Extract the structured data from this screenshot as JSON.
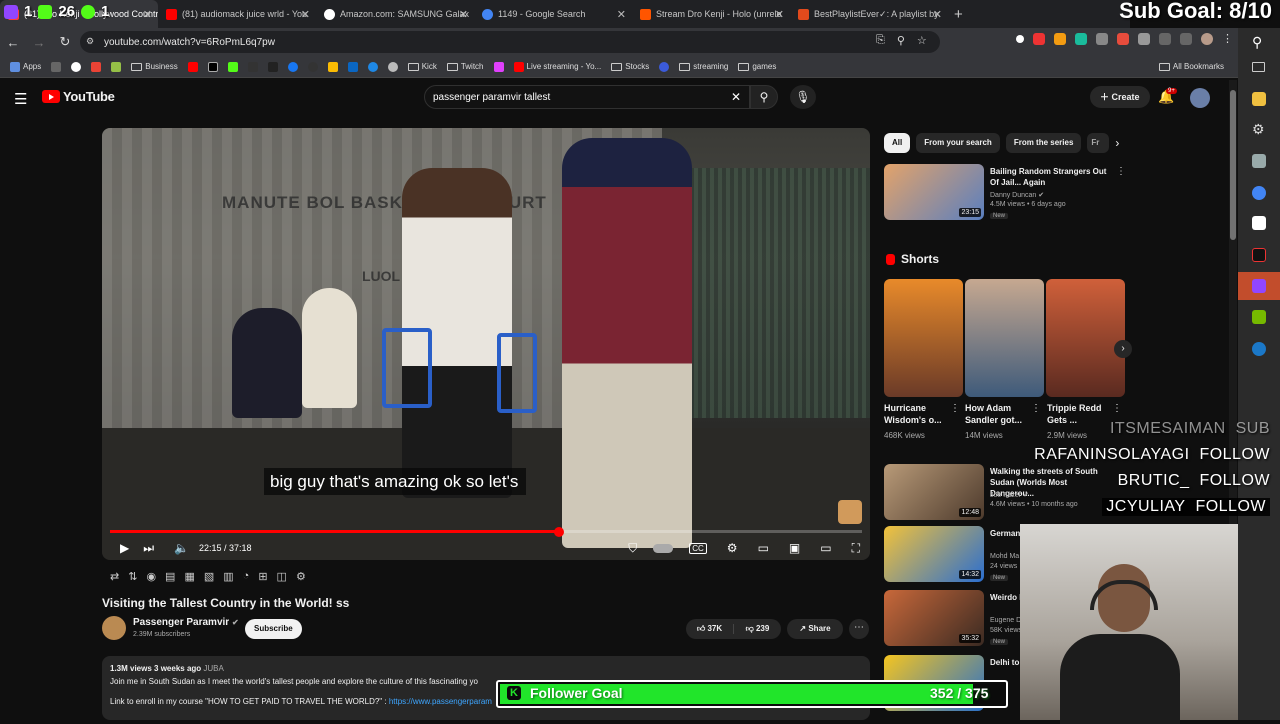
{
  "browser": {
    "tabs": [
      {
        "title": "(81) Dro Kenji - Hollywood Country",
        "color": "#ff3b3b"
      },
      {
        "title": "(81) audiomack juice wrld - You",
        "color": "#ff0000"
      },
      {
        "title": "Amazon.com: SAMSUNG Galax",
        "color": "#ffffff"
      },
      {
        "title": "1149 - Google Search",
        "color": "#4285f4"
      },
      {
        "title": "Stream Dro Kenji - Holo (unrele",
        "color": "#ff5500"
      },
      {
        "title": "BestPlaylistEver✓: A playlist by",
        "color": "#e24a1c"
      }
    ],
    "url": "youtube.com/watch?v=6RoPmL6q7pw",
    "bookmarks": [
      "Apps",
      "Business",
      "Kick",
      "Twitch",
      "Live streaming - Yo...",
      "Stocks",
      "streaming",
      "games"
    ],
    "all_bookmarks": "All Bookmarks"
  },
  "stream_overlay": {
    "sub_goal": "Sub Goal: 8/10",
    "twitch_stats": [
      "1",
      "26",
      "1"
    ],
    "events": [
      {
        "name": "ITSMESAIMAN",
        "action": "SUB"
      },
      {
        "name": "RAFANINSOLAYAGI",
        "action": "FOLLOW"
      },
      {
        "name": "BRUTIC_",
        "action": "FOLLOW"
      },
      {
        "name": "JCYULIAY",
        "action": "FOLLOW"
      }
    ],
    "follower_goal_label": "Follower Goal",
    "follower_goal_current": 352,
    "follower_goal_target": 375,
    "follower_goal_text": "352 / 375"
  },
  "youtube": {
    "logo": "YouTube",
    "search_query": "passenger paramvir  tallest",
    "create_label": "Create",
    "notification_count": "9+",
    "player": {
      "caption": "big guy that's amazing ok so let's",
      "time": "22:15 / 37:18",
      "progress": 0.597,
      "sign_text": "MANUTE BOL BASKETBALL COURT",
      "sign_text_2": "LUOL DENG"
    },
    "video": {
      "title": "Visiting the Tallest Country in the World! ss",
      "channel": "Passenger Paramvir",
      "subscribers": "2.39M subscribers",
      "subscribe_label": "Subscribe",
      "likes": "37K",
      "dislikes": "239",
      "share_label": "Share",
      "description_meta": "1.3M views  3 weeks ago",
      "description_location": "JUBA",
      "description_line1": "Join me in South Sudan as I meet the world's tallest people and explore the culture of this fascinating yo",
      "description_line2": "Link to enroll in my course \"HOW TO GET PAID TO TRAVEL THE WORLD?\" :",
      "description_link": "https://www.passengerparam"
    },
    "chips": [
      "All",
      "From your search",
      "From the series",
      "Fr"
    ],
    "recommendations": [
      {
        "title": "Bailing Random Strangers Out Of Jail... Again",
        "channel": "Danny Duncan",
        "views": "4.5M views • 6 days ago",
        "duration": "23:15",
        "badge": "New",
        "color": "#c88a52"
      },
      {
        "title": "Walking the streets of South Sudan (Worlds Most Dangerou...",
        "channel": "Joe Fazer",
        "views": "4.6M views • 10 months ago",
        "duration": "12:48",
        "badge": "",
        "color": "#8a6b4d"
      },
      {
        "title": "Germany Suhana",
        "channel": "Mohd Ma",
        "views": "24 views",
        "duration": "14:32",
        "badge": "New",
        "color": "#4f8ad1"
      },
      {
        "title": "Weirdo F Screami",
        "channel": "Eugene D",
        "views": "58K views",
        "duration": "35:32",
        "badge": "New",
        "color": "#7a4e3a"
      },
      {
        "title": "Delhi to Flight Ex",
        "channel": "",
        "views": "",
        "duration": "",
        "badge": "",
        "color": "#3a7fd0"
      }
    ],
    "shorts_heading": "Shorts",
    "shorts": [
      {
        "title": "Hurricane Wisdom's o...",
        "views": "468K views",
        "color": "#d9651e"
      },
      {
        "title": "How Adam Sandler got...",
        "views": "14M views",
        "color": "#9c8570"
      },
      {
        "title": "Trippie Redd Gets ...",
        "views": "2.9M views",
        "color": "#b8462f"
      }
    ]
  }
}
